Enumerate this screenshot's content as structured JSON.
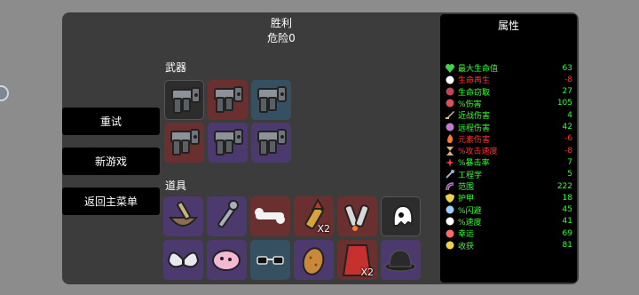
{
  "header": {
    "title": "胜利",
    "subtitle": "危险0"
  },
  "sections": {
    "weapons": "武器",
    "items": "道具"
  },
  "menu": {
    "retry": "重试",
    "new_game": "新游戏",
    "main_menu": "返回主菜单"
  },
  "weapons": [
    {
      "tier": "gray",
      "icon": "gun-icon"
    },
    {
      "tier": "red",
      "icon": "gun-icon"
    },
    {
      "tier": "blue",
      "icon": "gun-icon"
    },
    {
      "tier": "red",
      "icon": "gun-icon"
    },
    {
      "tier": "purple",
      "icon": "gun-icon"
    },
    {
      "tier": "purple",
      "icon": "gun-icon"
    }
  ],
  "items": [
    {
      "tier": "purple",
      "icon": "mortar-bowl-icon",
      "qty": ""
    },
    {
      "tier": "purple",
      "icon": "wrench-icon",
      "qty": ""
    },
    {
      "tier": "red",
      "icon": "bone-icon",
      "qty": ""
    },
    {
      "tier": "red",
      "icon": "bullet-icon",
      "qty": "X2"
    },
    {
      "tier": "red",
      "icon": "rockets-icon",
      "qty": ""
    },
    {
      "tier": "gray",
      "icon": "ghost-icon",
      "qty": ""
    },
    {
      "tier": "purple",
      "icon": "wings-icon",
      "qty": ""
    },
    {
      "tier": "purple",
      "icon": "pink-blob-icon",
      "qty": ""
    },
    {
      "tier": "blue",
      "icon": "sunglasses-icon",
      "qty": ""
    },
    {
      "tier": "purple",
      "icon": "potato-icon",
      "qty": ""
    },
    {
      "tier": "red",
      "icon": "cape-icon",
      "qty": "X2"
    },
    {
      "tier": "purple",
      "icon": "bowler-hat-icon",
      "qty": ""
    }
  ],
  "stats": {
    "title": "属性",
    "rows": [
      {
        "label": "最大生命值",
        "value": "63",
        "color": "#33ff33",
        "icon": "heart-icon",
        "icon_color": "#3fd24a"
      },
      {
        "label": "生命再生",
        "value": "-8",
        "color": "#ff3333",
        "icon": "regen-icon",
        "icon_color": "#ffffff"
      },
      {
        "label": "生命窃取",
        "value": "27",
        "color": "#33ff33",
        "icon": "lifesteal-icon",
        "icon_color": "#c0455a"
      },
      {
        "label": "%伤害",
        "value": "105",
        "color": "#33ff33",
        "icon": "damage-icon",
        "icon_color": "#d9505a"
      },
      {
        "label": "近战伤害",
        "value": "4",
        "color": "#33ff33",
        "icon": "sword-icon",
        "icon_color": "#e2c07a"
      },
      {
        "label": "远程伤害",
        "value": "42",
        "color": "#33ff33",
        "icon": "ranged-icon",
        "icon_color": "#c07ad0"
      },
      {
        "label": "元素伤害",
        "value": "-6",
        "color": "#ff3333",
        "icon": "fire-icon",
        "icon_color": "#ff7a2a"
      },
      {
        "label": "%攻击速度",
        "value": "-8",
        "color": "#ff3333",
        "icon": "hourglass-icon",
        "icon_color": "#d7b07a"
      },
      {
        "label": "%暴击率",
        "value": "7",
        "color": "#33ff33",
        "icon": "crit-icon",
        "icon_color": "#ff4040"
      },
      {
        "label": "工程学",
        "value": "5",
        "color": "#33ff33",
        "icon": "wrench-icon",
        "icon_color": "#9bb1c6"
      },
      {
        "label": "范围",
        "value": "222",
        "color": "#33ff33",
        "icon": "range-icon",
        "icon_color": "#c07ad0"
      },
      {
        "label": "护甲",
        "value": "18",
        "color": "#33ff33",
        "icon": "shield-icon",
        "icon_color": "#f0d24a"
      },
      {
        "label": "%闪避",
        "value": "45",
        "color": "#33ff33",
        "icon": "dodge-icon",
        "icon_color": "#9bd0ff"
      },
      {
        "label": "%速度",
        "value": "41",
        "color": "#33ff33",
        "icon": "speed-icon",
        "icon_color": "#ffffff"
      },
      {
        "label": "幸运",
        "value": "69",
        "color": "#33ff33",
        "icon": "luck-icon",
        "icon_color": "#ff6a6a"
      },
      {
        "label": "收获",
        "value": "81",
        "color": "#33ff33",
        "icon": "harvest-icon",
        "icon_color": "#f0d24a"
      }
    ]
  }
}
